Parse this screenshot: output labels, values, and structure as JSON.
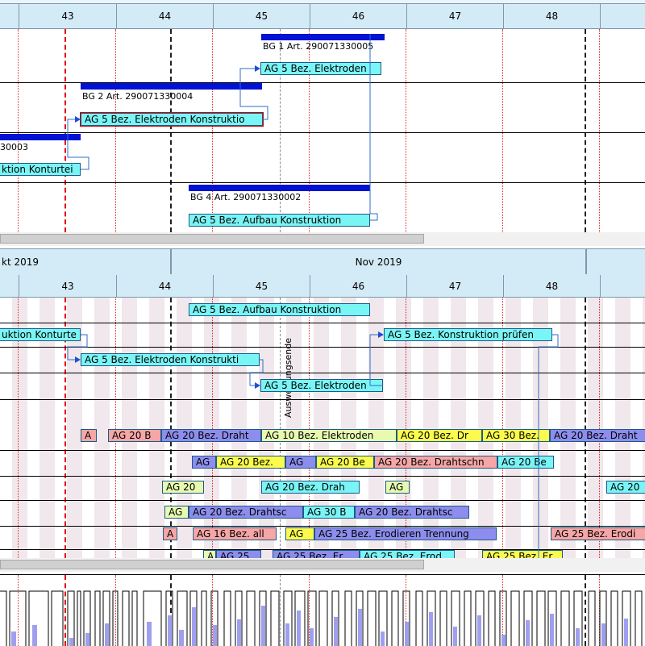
{
  "top_header": {
    "weeks": [
      "43",
      "44",
      "45",
      "46",
      "47",
      "48"
    ]
  },
  "top_gantt": {
    "bars": [
      {
        "label": "BG 1  Art. 290071330005"
      },
      {
        "label": "BG 2  Art. 290071330004"
      },
      {
        "label": "30003"
      },
      {
        "label": "BG 4  Art. 290071330002"
      }
    ],
    "tasks": [
      {
        "label": "AG 5 Bez. Elektroden"
      },
      {
        "label": "AG 5 Bez. Elektroden Konstruktio"
      },
      {
        "label": "ktion Konturtei"
      },
      {
        "label": "AG 5 Bez. Aufbau Konstruktion"
      }
    ]
  },
  "bottom_header": {
    "months": [
      "kt 2019",
      "Nov 2019"
    ],
    "weeks": [
      "43",
      "44",
      "45",
      "46",
      "47",
      "48"
    ]
  },
  "marker": {
    "label": "Auswertungsende"
  },
  "bottom_gantt": {
    "row1": [
      "AG 5 Bez. Aufbau Konstruktion"
    ],
    "row2": [
      "uktion Konturte",
      "AG 5 Bez. Konstruktion prüfen"
    ],
    "row3": [
      "AG 5 Bez. Elektroden Konstrukti"
    ],
    "row4": [
      "AG 5 Bez. Elektroden"
    ],
    "row5": [
      "A",
      "AG 20 B",
      "AG 20 Bez. Draht",
      "AG 10 Bez. Elektroden",
      "AG 20 Bez. Dr",
      "AG 30 Bez.",
      "AG 20 Bez. Draht"
    ],
    "row6": [
      "AG",
      "AG 20 Bez.",
      "AG",
      "AG 20 Be",
      "AG 20 Bez. Drahtschn",
      "AG 20 Be"
    ],
    "row7": [
      "AG 20",
      "AG 20 Bez. Drah",
      "AG",
      "AG 20"
    ],
    "row8": [
      "AG",
      "AG 20 Bez. Drahtsc",
      "AG 30 B",
      "AG 20 Bez. Drahtsc"
    ],
    "row9": [
      "A",
      "AG 16 Bez. all",
      "AG",
      "AG 25 Bez. Erodieren Trennung",
      "AG 25 Bez. Erodi"
    ],
    "row10": [
      "A",
      "AG 25",
      "AG 25 Bez. Er",
      "AG 25 Bez. Erod",
      "AG 25 Bez. Er"
    ]
  },
  "colors": {
    "header": "#d3ebf7",
    "bar": "#0012d4",
    "cyan": "#7af5f5",
    "pink": "#f7a6a6",
    "purple": "#8d8ded",
    "yellow": "#fbfb4e",
    "lightgreen": "#e7fab0"
  }
}
